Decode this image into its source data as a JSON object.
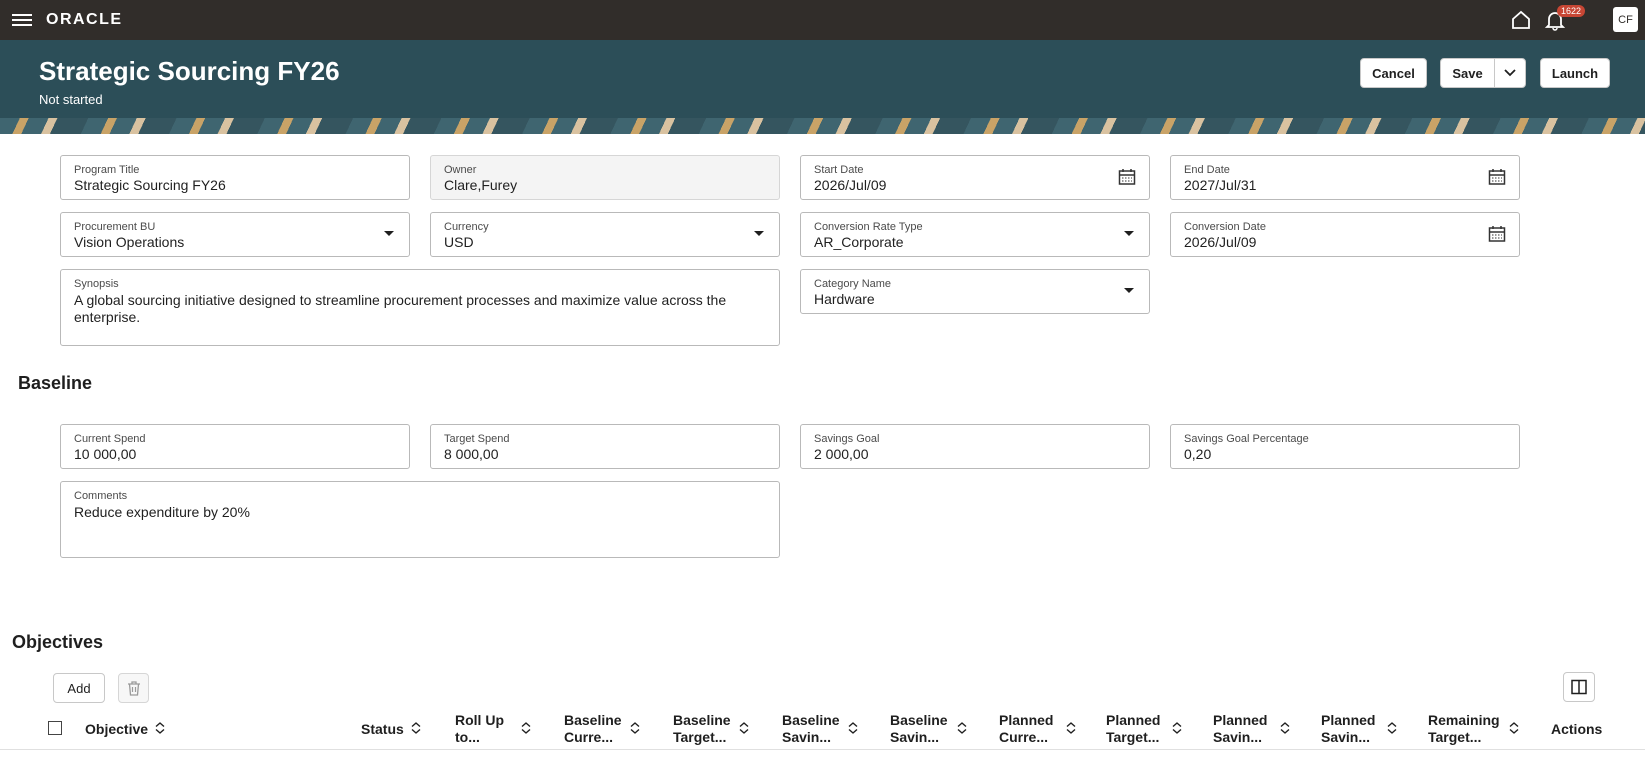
{
  "app": {
    "logo": "ORACLE",
    "notifications": "1622",
    "avatar": "CF"
  },
  "header": {
    "title": "Strategic Sourcing FY26",
    "status": "Not started",
    "cancel_label": "Cancel",
    "save_label": "Save",
    "launch_label": "Launch"
  },
  "form": {
    "program_title": {
      "label": "Program Title",
      "value": "Strategic Sourcing FY26"
    },
    "owner": {
      "label": "Owner",
      "value": "Clare,Furey"
    },
    "start_date": {
      "label": "Start Date",
      "value": "2026/Jul/09"
    },
    "end_date": {
      "label": "End Date",
      "value": "2027/Jul/31"
    },
    "procurement_bu": {
      "label": "Procurement BU",
      "value": "Vision Operations"
    },
    "currency": {
      "label": "Currency",
      "value": "USD"
    },
    "conversion_rate_type": {
      "label": "Conversion Rate Type",
      "value": "AR_Corporate"
    },
    "conversion_date": {
      "label": "Conversion Date",
      "value": "2026/Jul/09"
    },
    "synopsis": {
      "label": "Synopsis",
      "value": " A global sourcing initiative designed to streamline procurement processes and maximize value across the enterprise."
    },
    "category_name": {
      "label": "Category Name",
      "value": "Hardware"
    }
  },
  "baseline": {
    "title": "Baseline",
    "current_spend": {
      "label": "Current Spend",
      "value": "10 000,00"
    },
    "target_spend": {
      "label": "Target Spend",
      "value": "8 000,00"
    },
    "savings_goal": {
      "label": "Savings Goal",
      "value": "2 000,00"
    },
    "savings_goal_pct": {
      "label": "Savings Goal Percentage",
      "value": "0,20"
    },
    "comments": {
      "label": "Comments",
      "value": " Reduce expenditure by 20%"
    }
  },
  "objectives": {
    "title": "Objectives",
    "add_label": "Add",
    "columns": [
      {
        "l1": "Objective",
        "l2": ""
      },
      {
        "l1": "Status",
        "l2": ""
      },
      {
        "l1": "Roll Up",
        "l2": "to..."
      },
      {
        "l1": "Baseline",
        "l2": "Curre..."
      },
      {
        "l1": "Baseline",
        "l2": "Target..."
      },
      {
        "l1": "Baseline",
        "l2": "Savin..."
      },
      {
        "l1": "Baseline",
        "l2": "Savin..."
      },
      {
        "l1": "Planned",
        "l2": "Curre..."
      },
      {
        "l1": "Planned",
        "l2": "Target..."
      },
      {
        "l1": "Planned",
        "l2": "Savin..."
      },
      {
        "l1": "Planned",
        "l2": "Savin..."
      },
      {
        "l1": "Remaining",
        "l2": "Target..."
      },
      {
        "l1": "Actions",
        "l2": ""
      }
    ]
  }
}
